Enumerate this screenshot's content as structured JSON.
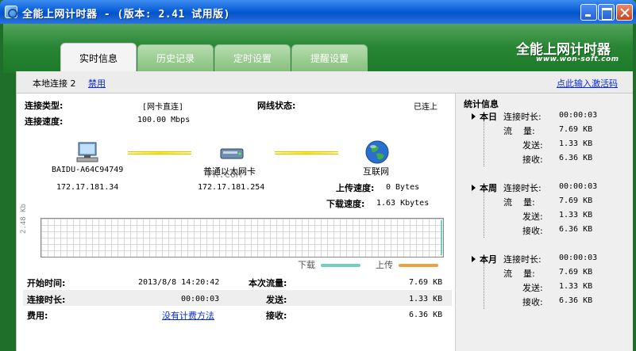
{
  "window": {
    "title": "全能上网计时器 - (版本: 2.41 试用版)"
  },
  "brand": {
    "name": "全能上网计时器",
    "url": "www.won-soft.com"
  },
  "tabs": [
    {
      "label": "实时信息",
      "active": true
    },
    {
      "label": "历史记录",
      "active": false
    },
    {
      "label": "定时设置",
      "active": false
    },
    {
      "label": "提醒设置",
      "active": false
    }
  ],
  "topbar": {
    "connection_name": "本地连接 2",
    "disable_link": "禁用",
    "activate_link": "点此输入激活码"
  },
  "conn": {
    "type_label": "连接类型:",
    "type_value": "[网卡直连]",
    "speed_label": "连接速度:",
    "speed_value": "100.00 Mbps",
    "line_status_label": "网线状态:",
    "line_status_value": "已连上"
  },
  "topology": {
    "computer_name": "BAIDU-A64C94749",
    "computer_ip": "172.17.181.34",
    "adapter_name": "普通以太网卡",
    "adapter_ip": "172.17.181.254",
    "internet_label": "互联网"
  },
  "watermark": "PK.COM",
  "rates": {
    "upload_label": "上传速度:",
    "upload_value": "0 Bytes",
    "download_label": "下载速度:",
    "download_value": "1.63 Kbytes"
  },
  "graph": {
    "scale_label": "2.48 Kb",
    "legend_download": "下载",
    "legend_upload": "上传",
    "download_color": "#6fd0c0",
    "upload_color": "#f0a040"
  },
  "session": {
    "start_label": "开始时间:",
    "start_value": "2013/8/8 14:20:42",
    "duration_label": "连接时长:",
    "duration_value": "00:00:03",
    "fee_label": "费用:",
    "fee_link": "没有计费方法",
    "traffic_label": "本次流量:",
    "traffic_value": "7.69 KB",
    "sent_label": "发送:",
    "sent_value": "1.33 KB",
    "recv_label": "接收:",
    "recv_value": "6.36 KB"
  },
  "stats": {
    "title": "统计信息",
    "groups": [
      {
        "name": "本日",
        "duration_label": "连接时长:",
        "duration": "00:00:03",
        "traffic_label": "流    量:",
        "traffic": "7.69 KB",
        "sent_label": "发送:",
        "sent": "1.33 KB",
        "recv_label": "接收:",
        "recv": "6.36 KB"
      },
      {
        "name": "本周",
        "duration_label": "连接时长:",
        "duration": "00:00:03",
        "traffic_label": "流    量:",
        "traffic": "7.69 KB",
        "sent_label": "发送:",
        "sent": "1.33 KB",
        "recv_label": "接收:",
        "recv": "6.36 KB"
      },
      {
        "name": "本月",
        "duration_label": "连接时长:",
        "duration": "00:00:03",
        "traffic_label": "流    量:",
        "traffic": "7.69 KB",
        "sent_label": "发送:",
        "sent": "1.33 KB",
        "recv_label": "接收:",
        "recv": "6.36 KB"
      }
    ]
  }
}
